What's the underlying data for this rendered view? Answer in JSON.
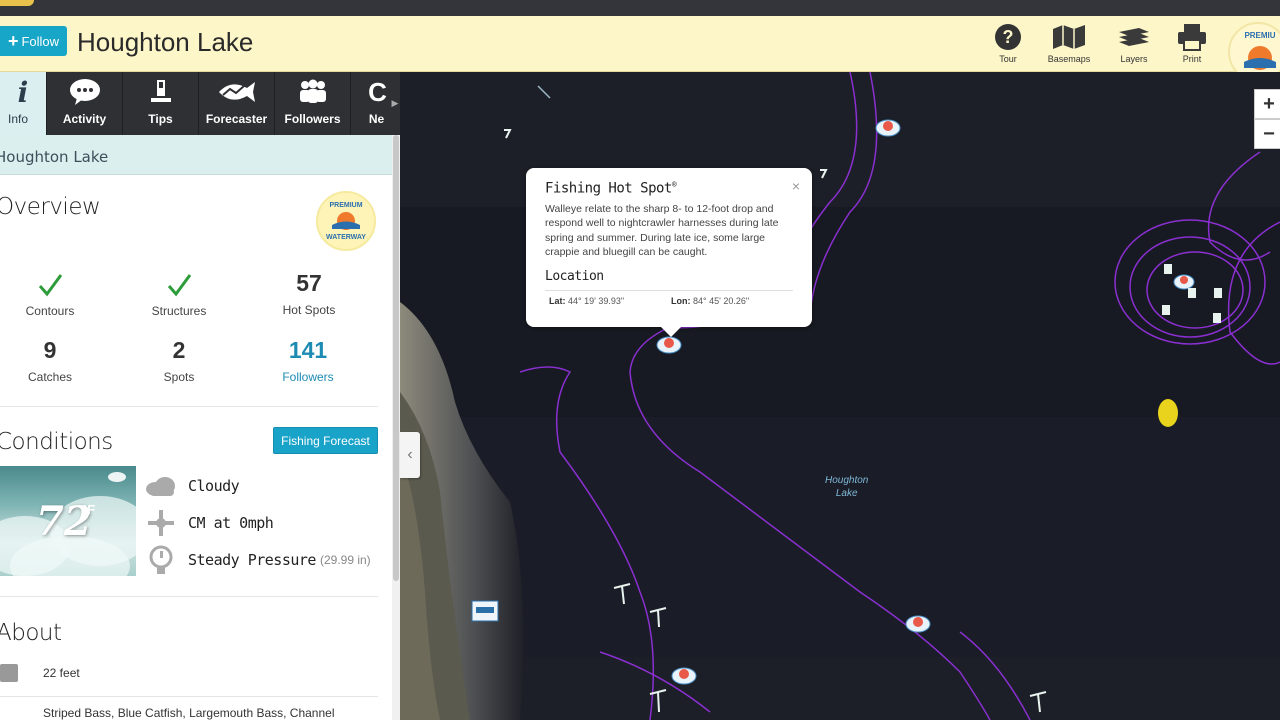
{
  "header": {
    "follow_label": "Follow",
    "title": "Houghton Lake",
    "tools": [
      {
        "label": "Tour",
        "icon": "help-icon"
      },
      {
        "label": "Basemaps",
        "icon": "map-icon"
      },
      {
        "label": "Layers",
        "icon": "layers-icon"
      },
      {
        "label": "Print",
        "icon": "printer-icon"
      }
    ],
    "premium_badge": "PREMIUM WATERWAY"
  },
  "tabs": [
    {
      "label": "Info",
      "icon": "info-icon"
    },
    {
      "label": "Activity",
      "icon": "chat-bubble-icon"
    },
    {
      "label": "Tips",
      "icon": "pencil-icon"
    },
    {
      "label": "Forecaster",
      "icon": "fish-graph-icon"
    },
    {
      "label": "Followers",
      "icon": "people-icon"
    },
    {
      "label": "Ne",
      "icon": "news-icon"
    }
  ],
  "breadcrumb": "Houghton Lake",
  "overview": {
    "title": "Overview",
    "badge_top": "PREMIUM",
    "badge_bottom": "WATERWAY",
    "stats": [
      {
        "label": "Contours",
        "value": "check"
      },
      {
        "label": "Structures",
        "value": "check"
      },
      {
        "label": "Hot Spots",
        "value": "57"
      },
      {
        "label": "Catches",
        "value": "9"
      },
      {
        "label": "Spots",
        "value": "2"
      },
      {
        "label": "Followers",
        "value": "141"
      }
    ]
  },
  "conditions": {
    "title": "Conditions",
    "forecast_button": "Fishing Forecast",
    "temperature": "72",
    "unit": "°F",
    "sky": "Cloudy",
    "wind": "CM at 0mph",
    "pressure": "Steady Pressure",
    "pressure_value": "(29.99 in)"
  },
  "about": {
    "title": "About",
    "depth": "22 feet",
    "species": "Striped Bass, Blue Catfish, Largemouth Bass, Channel"
  },
  "popup": {
    "title": "Fishing Hot Spot",
    "close": "×",
    "description": "Walleye relate to the sharp 8- to 12-foot drop and respond well to nightcrawler harnesses during late spring and summer. During late ice, some large crappie and bluegill can be caught.",
    "location_heading": "Location",
    "lat_label": "Lat:",
    "lat_value": "44° 19' 39.93\"",
    "lon_label": "Lon:",
    "lon_value": "84° 45' 20.26\""
  },
  "map": {
    "lake_label_1": "Houghton",
    "lake_label_2": "Lake",
    "zoom_in": "+",
    "zoom_out": "−",
    "collapse": "‹"
  },
  "colors": {
    "header_bg": "#fdf6c9",
    "accent": "#17a5c8",
    "tab_bar": "#2f3034",
    "contour": "#8a2fd0",
    "check": "#2e9c3a"
  }
}
